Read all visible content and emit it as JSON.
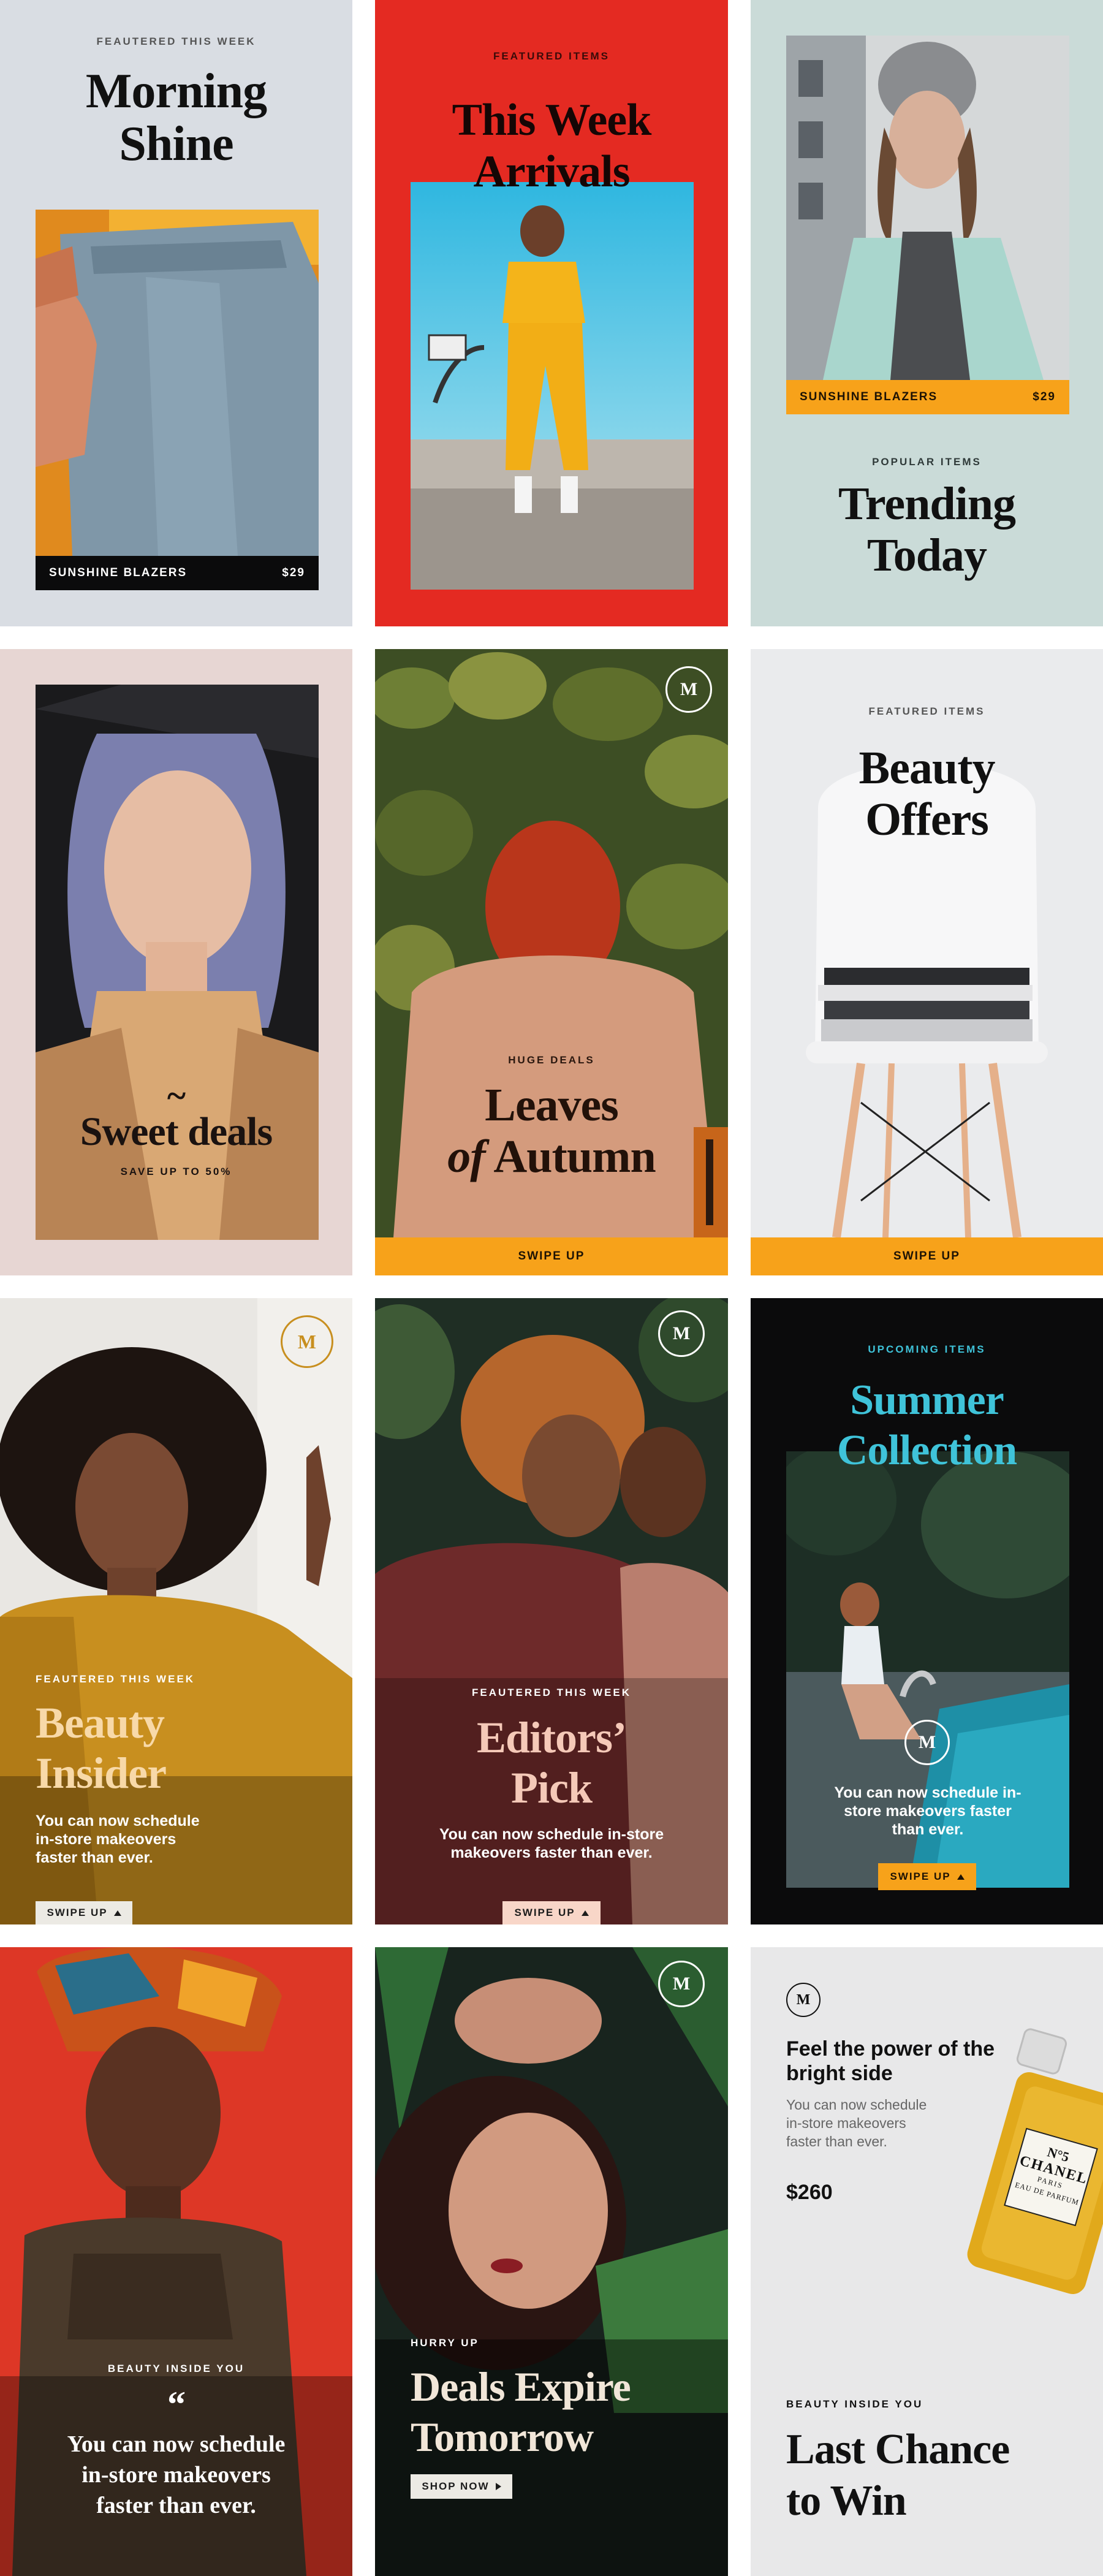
{
  "palette": {
    "gray_blue": "#d9dde3",
    "red": "#e42a22",
    "mint": "#cadbd8",
    "blush": "#e7d6d3",
    "orange": "#f7a21a",
    "black": "#0b0b0c",
    "light_gray": "#e9eaec"
  },
  "cards": {
    "c1": {
      "kicker": "FEAUTERED THIS WEEK",
      "title_1": "Morning",
      "title_2": "Shine",
      "bar_label": "SUNSHINE BLAZERS",
      "bar_price": "$29"
    },
    "c2": {
      "kicker": "FEATURED ITEMS",
      "title_1": "This Week",
      "title_2": "Arrivals"
    },
    "c3": {
      "bar_label": "SUNSHINE BLAZERS",
      "bar_price": "$29",
      "kicker": "POPULAR ITEMS",
      "title_1": "Trending",
      "title_2": "Today"
    },
    "c4": {
      "tilde": "~",
      "title": "Sweet deals",
      "sub": "SAVE UP TO 50%"
    },
    "c5": {
      "logo": "M",
      "kicker": "HUGE DEALS",
      "title_1": "Leaves",
      "title_2_italic": "of",
      "title_2": "Autumn",
      "bar_label": "SWIPE UP"
    },
    "c6": {
      "kicker": "FEATURED ITEMS",
      "title_1": "Beauty",
      "title_2": "Offers",
      "bar_label": "SWIPE UP"
    },
    "c7": {
      "logo": "M",
      "kicker": "FEAUTERED THIS WEEK",
      "title_1": "Beauty",
      "title_2": "Insider",
      "body_1": "You can now schedule",
      "body_2": "in-store makeovers",
      "body_3": "faster than ever.",
      "pill": "SWIPE UP"
    },
    "c8": {
      "logo": "M",
      "kicker": "FEAUTERED THIS WEEK",
      "title_1": "Editors’",
      "title_2": "Pick",
      "body_1": "You can now schedule in-store",
      "body_2": "makeovers faster than ever.",
      "pill": "SWIPE UP"
    },
    "c9": {
      "kicker": "UPCOMING ITEMS",
      "title_1": "Summer",
      "title_2": "Collection",
      "logo": "M",
      "body_1": "You can now schedule in-",
      "body_2": "store makeovers faster",
      "body_3": "than ever.",
      "pill": "SWIPE UP"
    },
    "c10": {
      "kicker": "BEAUTY INSIDE YOU",
      "quote_mark": "“",
      "body_1": "You can now schedule",
      "body_2": "in-store makeovers",
      "body_3": "faster than ever."
    },
    "c11": {
      "logo": "M",
      "kicker": "HURRY UP",
      "title_1": "Deals Expire",
      "title_2": "Tomorrow",
      "pill": "SHOP NOW"
    },
    "c12": {
      "logo": "M",
      "head_1": "Feel the power of the",
      "head_2": "bright side",
      "body_1": "You can now schedule",
      "body_2": "in-store makeovers",
      "body_3": "faster than ever.",
      "price": "$260",
      "bottle_1": "N°5",
      "bottle_2": "CHANEL",
      "bottle_3": "PARIS",
      "bottle_4": "EAU DE PARFUM",
      "kicker": "BEAUTY INSIDE YOU",
      "title_1": "Last Chance",
      "title_2": "to Win"
    }
  }
}
